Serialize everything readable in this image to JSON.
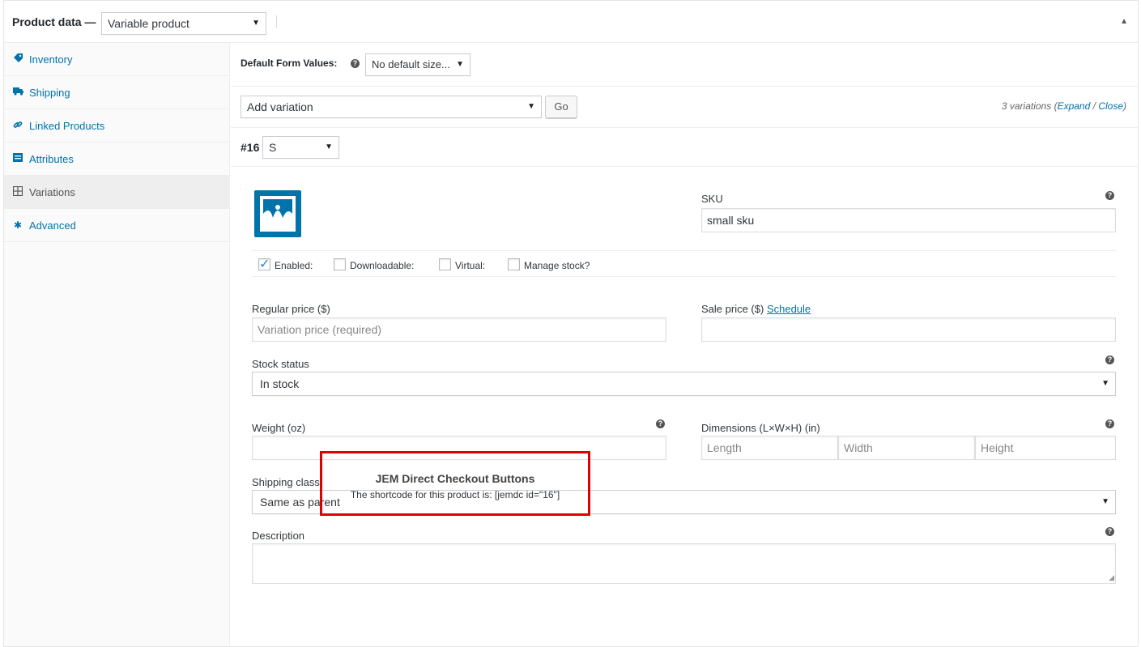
{
  "header": {
    "title": "Product data —",
    "product_type": "Variable product"
  },
  "tabs": [
    {
      "label": "Inventory",
      "icon": "inventory-icon"
    },
    {
      "label": "Shipping",
      "icon": "truck-icon"
    },
    {
      "label": "Linked Products",
      "icon": "link-icon"
    },
    {
      "label": "Attributes",
      "icon": "attributes-icon"
    },
    {
      "label": "Variations",
      "icon": "grid-icon",
      "active": true
    },
    {
      "label": "Advanced",
      "icon": "gear-icon"
    }
  ],
  "defaults": {
    "label": "Default Form Values:",
    "value": "No default size..."
  },
  "variations_bar": {
    "action": "Add variation",
    "go": "Go",
    "count": "3 variations",
    "expand": "Expand",
    "sep": "/",
    "close": "Close"
  },
  "variation": {
    "number": "#16",
    "size": "S",
    "sku_label": "SKU",
    "sku_value": "small sku",
    "enabled_label": "Enabled:",
    "downloadable_label": "Downloadable:",
    "virtual_label": "Virtual:",
    "manage_stock_label": "Manage stock?",
    "regular_price_label": "Regular price ($)",
    "regular_price_placeholder": "Variation price (required)",
    "sale_price_label": "Sale price ($)",
    "schedule_link": "Schedule",
    "stock_status_label": "Stock status",
    "stock_status_value": "In stock",
    "weight_label": "Weight (oz)",
    "dimensions_label": "Dimensions (L×W×H) (in)",
    "length_placeholder": "Length",
    "width_placeholder": "Width",
    "height_placeholder": "Height",
    "shipping_class_label": "Shipping class",
    "shipping_class_value": "Same as parent",
    "description_label": "Description"
  },
  "jem": {
    "title": "JEM Direct Checkout Buttons",
    "shortcode_text": "The shortcode for this product is: [jemdc id=\"16\"]"
  },
  "colors": {
    "link": "#0073aa",
    "highlight_border": "#e00000"
  }
}
